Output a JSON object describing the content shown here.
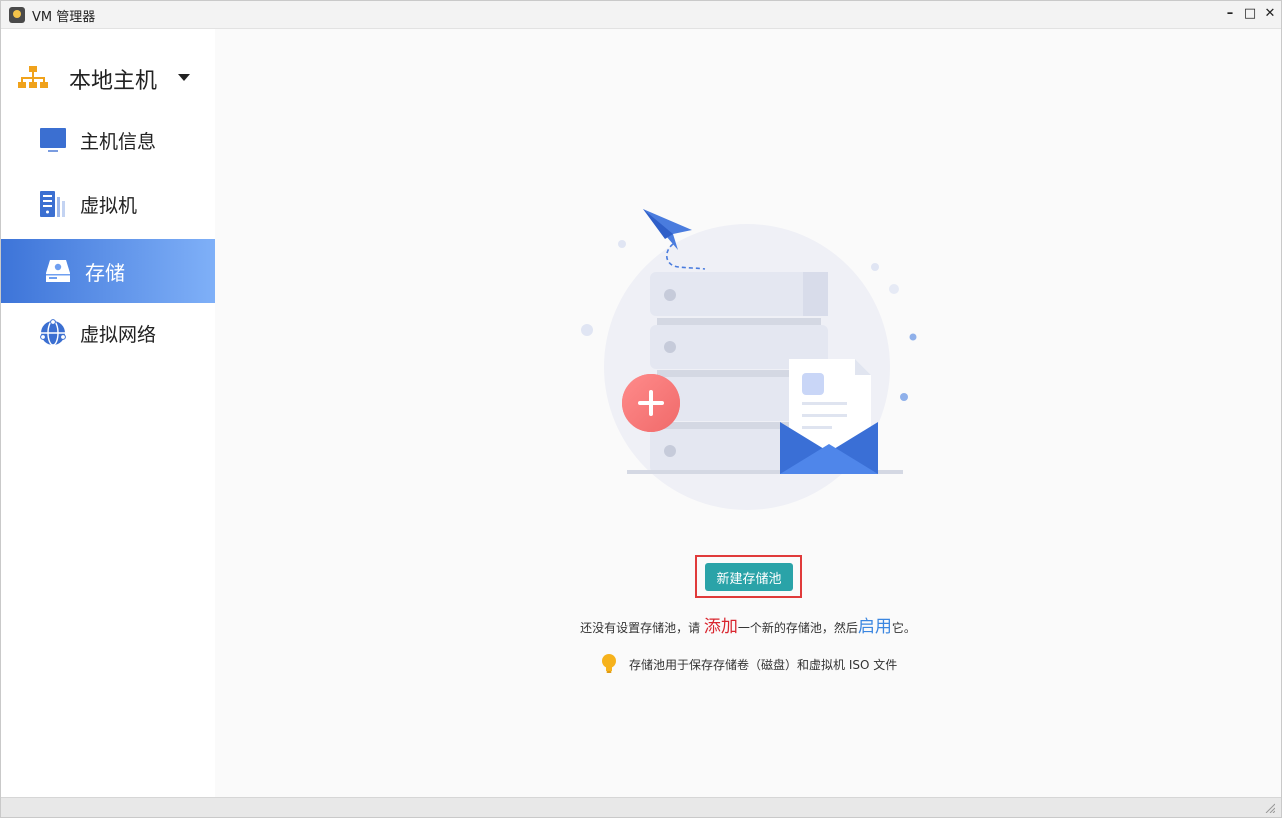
{
  "window": {
    "title": "VM 管理器",
    "controls": {
      "minimize": "–",
      "maximize": "□",
      "close": "✕"
    }
  },
  "sidebar": {
    "host": {
      "label": "本地主机",
      "icon": "network-hierarchy-icon"
    },
    "items": [
      {
        "label": "主机信息",
        "icon": "monitor-icon",
        "active": false
      },
      {
        "label": "虚拟机",
        "icon": "server-icon",
        "active": false
      },
      {
        "label": "存储",
        "icon": "storage-drive-icon",
        "active": true
      },
      {
        "label": "虚拟网络",
        "icon": "globe-network-icon",
        "active": false
      }
    ]
  },
  "main": {
    "empty_state": {
      "illustration": "storage-server-illustration",
      "button_label": "新建存储池",
      "hint": {
        "prefix": "还没有设置存储池，请 ",
        "add": "添加",
        "middle": "一个新的存储池，然后",
        "enable": "启用",
        "suffix": "它。"
      },
      "tip": {
        "icon": "lightbulb-icon",
        "text": "存储池用于保存存储卷（磁盘）和虚拟机 ISO 文件"
      }
    }
  },
  "colors": {
    "accent_active": "#3d74d8",
    "primary_button": "#2aa3a8",
    "highlight_frame": "#e03a3a",
    "add_link": "#d9262f",
    "enable_link": "#3b86e0"
  }
}
